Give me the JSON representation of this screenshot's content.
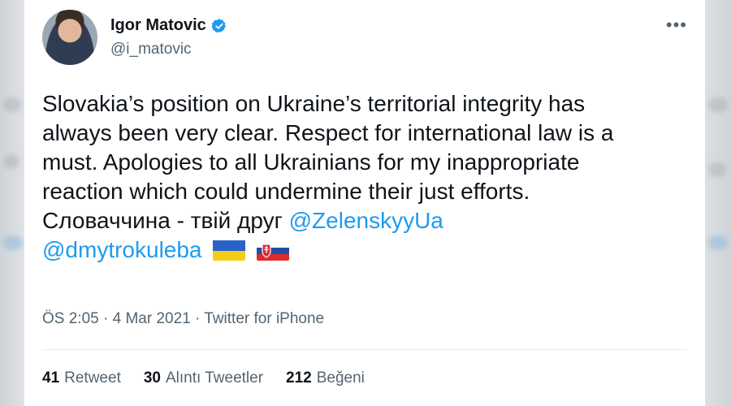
{
  "author": {
    "name": "Igor Matovic",
    "handle": "@i_matovic",
    "verified": true,
    "verified_color": "#1d9bf0"
  },
  "more_label": "•••",
  "tweet": {
    "line1": "Slovakia’s position on Ukraine’s territorial integrity has",
    "line2": "always been very clear. Respect for international law is a",
    "line3": "must. Apologies to all Ukrainians for my inappropriate",
    "line4": "reaction which could undermine their just efforts.",
    "line5_text": "Словаччина - твій друг ",
    "mention1": "@ZelenskyyUa",
    "mention2": "@dmytrokuleba",
    "flags": [
      "ukraine-flag-icon",
      "slovakia-flag-icon"
    ]
  },
  "meta": {
    "time": "ÖS 2:05",
    "sep1": " · ",
    "date": "4 Mar 2021",
    "sep2": " · ",
    "source": "Twitter for iPhone"
  },
  "stats": {
    "retweets_count": "41",
    "retweets_label": "Retweet",
    "quotes_count": "30",
    "quotes_label": "Alıntı Tweetler",
    "likes_count": "212",
    "likes_label": "Beğeni"
  },
  "colors": {
    "link": "#1d9bf0",
    "text": "#0f1419",
    "secondary": "#536471"
  }
}
